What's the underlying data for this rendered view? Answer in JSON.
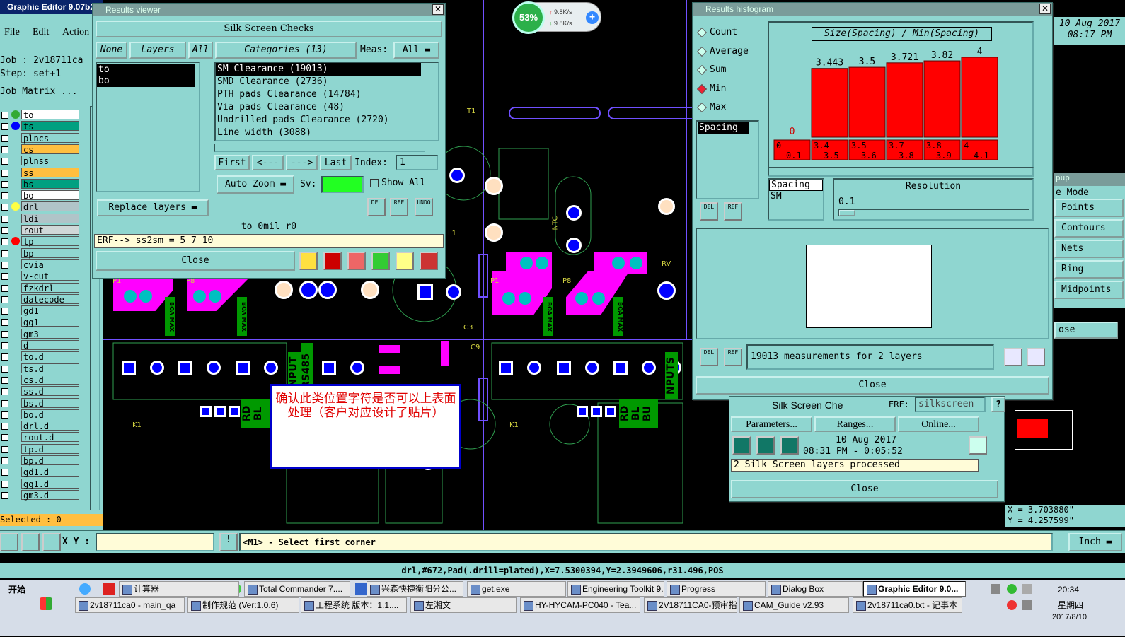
{
  "app": {
    "title": "Graphic Editor 9.07b2",
    "menu": [
      "File",
      "Edit",
      "Action"
    ],
    "job": "Job : 2v18711ca",
    "step": "Step: set+1",
    "job_matrix": "Job Matrix ...",
    "selected": "Selected : 0",
    "date": "10 Aug 2017",
    "time": "08:17 PM"
  },
  "layers": [
    "to",
    "ts",
    "plncs",
    "cs",
    "plnss",
    "ss",
    "bs",
    "bo",
    "drl",
    "ldi",
    "rout",
    "tp",
    "bp",
    "cvia",
    "v-cut",
    "fzkdrl",
    "datecode-bo",
    "gd1",
    "gg1",
    "gm3",
    "d",
    "to.d",
    "ts.d",
    "cs.d",
    "ss.d",
    "bs.d",
    "bo.d",
    "drl.d",
    "rout.d",
    "tp.d",
    "bp.d",
    "gd1.d",
    "gg1.d",
    "gm3.d"
  ],
  "layer_colors": {
    "to": "#ffffff",
    "ts": "#00a080",
    "plncs": "#8fd6d0",
    "cs": "#ffbf40",
    "plnss": "#8fd6d0",
    "ss": "#ffbf40",
    "bs": "#00a080",
    "bo": "#ffffff",
    "drl": "#b0c4c8",
    "ldi": "#b0c4c8",
    "rout": "#d0d8d8"
  },
  "net_speed": {
    "percent": "53%",
    "up": "9.8K/s",
    "down": "9.8K/s"
  },
  "results_viewer": {
    "title": "Results viewer",
    "header": "Silk Screen Checks",
    "none": "None",
    "layers": "Layers",
    "all": "All",
    "layer_list": [
      "to",
      "bo"
    ],
    "categories": "Categories (13)",
    "meas_label": "Meas:",
    "meas_value": "All",
    "category_list": [
      "SM Clearance (19013)",
      "SMD Clearance (2736)",
      "PTH pads Clearance (14784)",
      "Via pads Clearance (48)",
      "Undrilled pads Clearance (2720)",
      "Line width (3088)"
    ],
    "first": "First",
    "prev": "<---",
    "next": "--->",
    "last": "Last",
    "index_label": "Index:",
    "index_value": "1",
    "auto_zoom": "Auto Zoom",
    "sv_label": "Sv:",
    "show_all": "Show All",
    "replace_layers": "Replace layers",
    "del": "DEL",
    "ref": "REF",
    "undo": "UNDO",
    "status1": "to 0mil  r0",
    "status2": "ERF--> ss2sm = 5 7 10",
    "close": "Close"
  },
  "histogram": {
    "title": "Results histogram",
    "stats": [
      "Count",
      "Average",
      "Sum",
      "Min",
      "Max"
    ],
    "selected_stat": "Min",
    "chart_title": "Size(Spacing) / Min(Spacing)",
    "spacing_label": "Spacing",
    "spacing_sel": "Spacing",
    "spacing_sm": "SM",
    "resolution_label": "Resolution",
    "resolution_value": "0.1",
    "measurements": "19013 measurements for 2 layers",
    "close": "Close",
    "del": "DEL",
    "ref": "REF"
  },
  "chart_data": {
    "type": "bar",
    "title": "Size(Spacing) / Min(Spacing)",
    "categories": [
      "0-0.1",
      "3.4-3.5",
      "3.5-3.6",
      "3.7-3.8",
      "3.8-3.9",
      "4-4.1"
    ],
    "values": [
      0,
      3.443,
      3.5,
      3.721,
      3.82,
      4
    ],
    "value_labels": [
      "0",
      "3.443",
      "3.5",
      "3.721",
      "3.82",
      "4"
    ]
  },
  "silk_panel": {
    "title": "Silk Screen Che",
    "erf_label": "ERF:",
    "erf_value": "silkscreen",
    "help": "?",
    "parameters": "Parameters...",
    "ranges": "Ranges...",
    "online": "Online...",
    "run_date": "10 Aug 2017",
    "run_time": "08:31 PM - 0:05:52",
    "processed": "2 Silk Screen layers processed",
    "close": "Close"
  },
  "right_panel": {
    "popup": "pup",
    "mode": "e Mode",
    "items": [
      "Points",
      "Contours",
      "Nets",
      "Ring",
      "Midpoints"
    ],
    "close_partial": "ose",
    "x_coord": "X = 3.703880\"",
    "y_coord": "Y = 4.257599\""
  },
  "annotation": {
    "text": "确认此类位置字符是否可以上表面处理（客户对应设计了贴片）"
  },
  "pcb_labels": {
    "rs485": "RS485",
    "unput": "UNPUT",
    "nput": "NPUTS",
    "rdbl": "RD BL",
    "rdblbu": "RD BL BU",
    "p1": "P1",
    "p8": "P8",
    "c3": "C3",
    "c9": "C9",
    "k1": "K1",
    "j7": "J7",
    "ntc": "NTC",
    "rv": "RV",
    "ur": "L1",
    "t1": "T1",
    "boamax": "BOA MAX"
  },
  "cmdline": {
    "xy_label": "X Y :",
    "prompt": "<M1> - Select first corner",
    "unit": "Inch",
    "status": "drl,#672,Pad(.drill=plated),X=7.5300394,Y=2.3949606,r31.496,POS"
  },
  "taskbar": {
    "start": "开始",
    "row1": [
      "计算器",
      "Total Commander 7....",
      "兴森快捷衡阳分公...",
      "get.exe",
      "Engineering Toolkit 9...",
      "Progress",
      "Dialog Box",
      "Graphic Editor 9.0..."
    ],
    "row2": [
      "2v18711ca0 - main_qa",
      "制作规范 (Ver:1.0.6)",
      "工程系统  版本：1.1....",
      "左湘文",
      "HY-HYCAM-PC040 - Tea...",
      "2V18711CA0-预审指示...",
      "CAM_Guide v2.93",
      "2v18711ca0.txt - 记事本"
    ],
    "clock": "20:34",
    "weekday": "星期四",
    "date": "2017/8/10"
  }
}
